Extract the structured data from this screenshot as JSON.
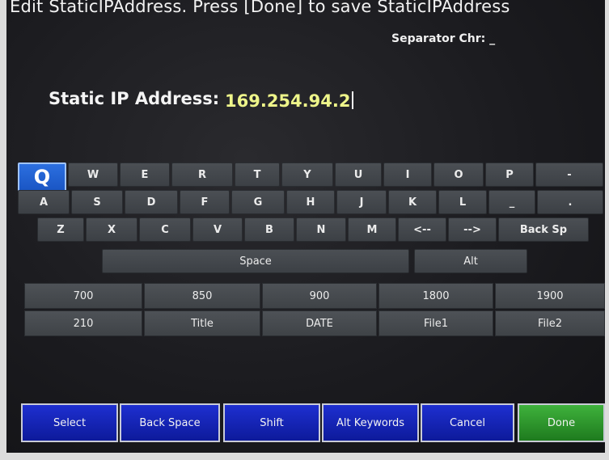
{
  "header": {
    "instruction": "Edit StaticIPAddress.  Press [Done] to save StaticIPAddress",
    "separator_label": "Separator Chr: _"
  },
  "field": {
    "label": "Static IP Address:",
    "value": "169.254.94.2"
  },
  "keyboard": {
    "row1": [
      "Q",
      "W",
      "E",
      "R",
      "T",
      "Y",
      "U",
      "I",
      "O",
      "P",
      "-"
    ],
    "row2": [
      "A",
      "S",
      "D",
      "F",
      "G",
      "H",
      "J",
      "K",
      "L",
      "_",
      "."
    ],
    "row3": [
      "Z",
      "X",
      "C",
      "V",
      "B",
      "N",
      "M",
      "<--",
      "-->",
      "Back Sp"
    ],
    "row4": [
      "Space",
      "Alt"
    ],
    "selected_key": "Q"
  },
  "keywords": {
    "row1": [
      "700",
      "850",
      "900",
      "1800",
      "1900"
    ],
    "row2": [
      "210",
      "Title",
      "DATE",
      "File1",
      "File2"
    ]
  },
  "buttons": {
    "select": "Select",
    "back_space": "Back Space",
    "shift": "Shift",
    "alt_keywords": "Alt Keywords",
    "cancel": "Cancel",
    "done": "Done"
  },
  "colors": {
    "button_blue": "#1a2bc4",
    "done_green": "#2f9a2c",
    "selected_key_blue": "#2463d6",
    "input_text": "#eef58a"
  }
}
